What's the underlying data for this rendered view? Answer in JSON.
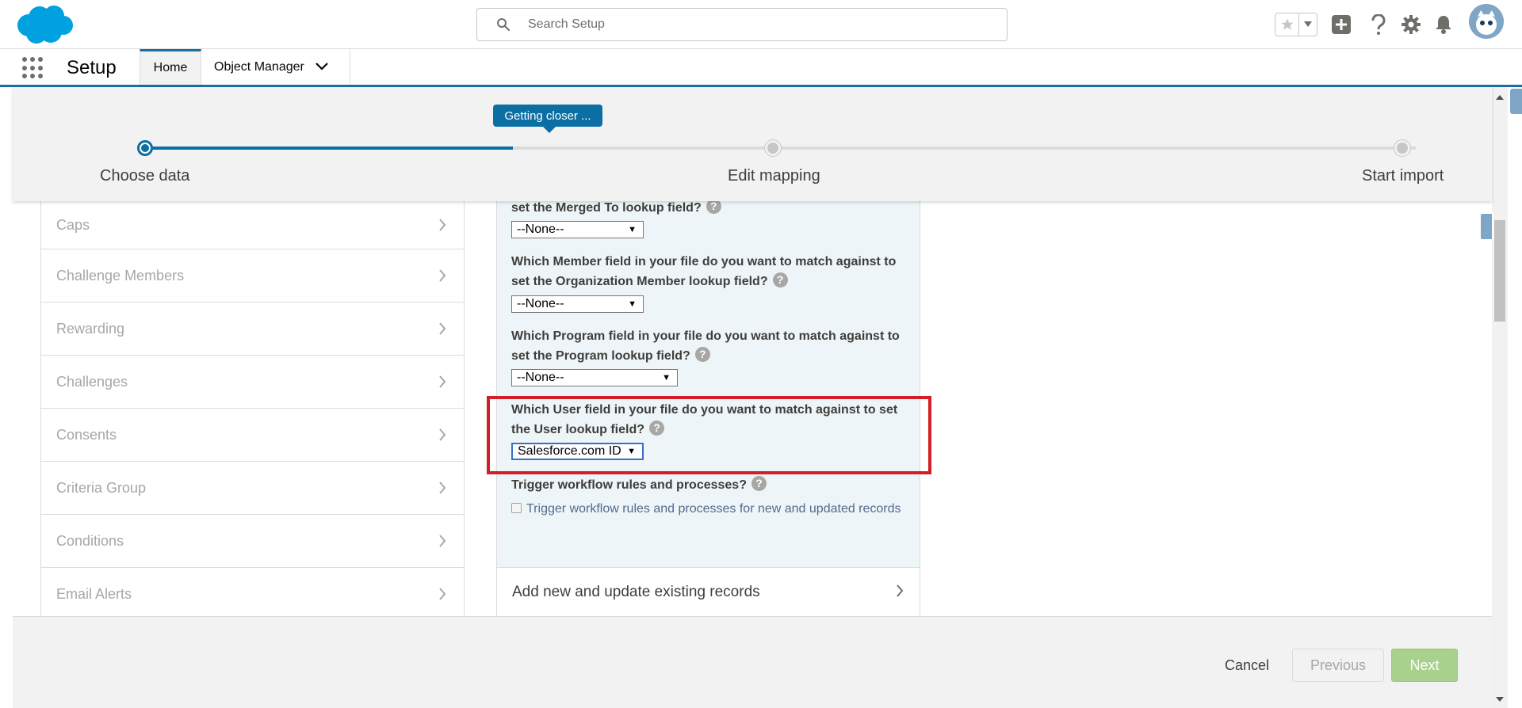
{
  "header": {
    "search_placeholder": "Search Setup",
    "icons": [
      "favorites-star-icon",
      "favorites-caret-icon",
      "add-icon",
      "help-icon",
      "setup-gear-icon",
      "notifications-bell-icon",
      "user-avatar"
    ]
  },
  "app_nav": {
    "app_name": "Setup",
    "tabs": [
      {
        "label": "Home"
      },
      {
        "label": "Object Manager"
      }
    ]
  },
  "progress": {
    "tooltip": "Getting closer ...",
    "steps": [
      {
        "label": "Choose data",
        "status": "complete"
      },
      {
        "label": "Edit mapping",
        "status": "upcoming"
      },
      {
        "label": "Start import",
        "status": "upcoming"
      }
    ],
    "fill_fraction": 0.29
  },
  "objects": [
    {
      "label": "Caps"
    },
    {
      "label": "Challenge Members"
    },
    {
      "label": "Rewarding"
    },
    {
      "label": "Challenges"
    },
    {
      "label": "Consents"
    },
    {
      "label": "Criteria Group"
    },
    {
      "label": "Conditions"
    },
    {
      "label": "Email Alerts"
    }
  ],
  "mapping": {
    "q_merged_tail": "set the Merged To lookup field?",
    "q_merged_value": "--None--",
    "q_org_member": "Which Member field in your file do you want to match against to set the Organization Member lookup field?",
    "q_org_member_value": "--None--",
    "q_program": "Which Program field in your file do you want to match against to set the Program lookup field?",
    "q_program_value": "--None--",
    "q_user": "Which User field in your file do you want to match against to set the User lookup field?",
    "q_user_value": "Salesforce.com ID",
    "q_trigger": "Trigger workflow rules and processes?",
    "trigger_checkbox_label": "Trigger workflow rules and processes for new and updated records",
    "trigger_checked": false,
    "help_glyph": "?"
  },
  "operation": {
    "label": "Add new and update existing records"
  },
  "footer": {
    "cancel": "Cancel",
    "previous": "Previous",
    "next": "Next"
  },
  "colors": {
    "brand_blue": "#0b6fa4",
    "highlight_red": "#d21f27",
    "next_button": "#a9d18e",
    "panel_bg": "#eef5f8"
  }
}
